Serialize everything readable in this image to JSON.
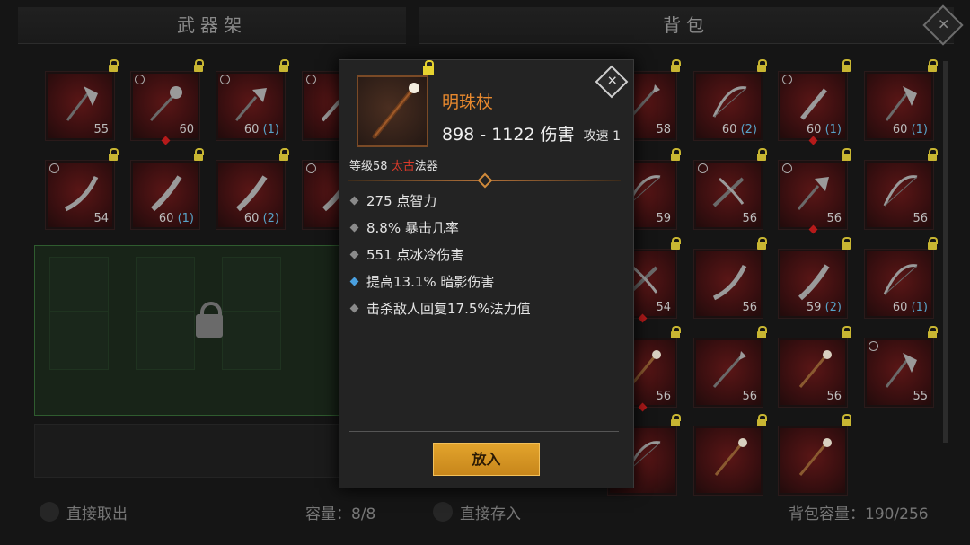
{
  "left_panel": {
    "title": "武器架",
    "footer_action": "直接取出",
    "footer_capacity": "容量：8/8",
    "slots": [
      {
        "level": "55",
        "enhance": "",
        "weapon": "axe",
        "ring": false,
        "gem": false
      },
      {
        "level": "60",
        "enhance": "",
        "weapon": "spiked-mace",
        "ring": true,
        "gem": true
      },
      {
        "level": "60",
        "enhance": "(1)",
        "weapon": "spiked-club",
        "ring": true,
        "gem": false
      },
      {
        "level": "",
        "enhance": "",
        "weapon": "sword",
        "ring": true,
        "gem": false
      },
      {
        "level": "54",
        "enhance": "",
        "weapon": "scimitar",
        "ring": true,
        "gem": false
      },
      {
        "level": "60",
        "enhance": "(1)",
        "weapon": "blade",
        "ring": false,
        "gem": false
      },
      {
        "level": "60",
        "enhance": "(2)",
        "weapon": "blade",
        "ring": false,
        "gem": false
      },
      {
        "level": "",
        "enhance": "",
        "weapon": "blade",
        "ring": true,
        "gem": false
      }
    ]
  },
  "right_panel": {
    "title": "背包",
    "footer_action": "直接存入",
    "footer_capacity": "背包容量：190/256",
    "slots": [
      {
        "level": "58",
        "enhance": "",
        "weapon": "spear",
        "ring": false,
        "gem": false
      },
      {
        "level": "60",
        "enhance": "(2)",
        "weapon": "bow",
        "ring": false,
        "gem": false
      },
      {
        "level": "60",
        "enhance": "(1)",
        "weapon": "dagger",
        "ring": true,
        "gem": true
      },
      {
        "level": "60",
        "enhance": "(1)",
        "weapon": "axe",
        "ring": false,
        "gem": false
      },
      {
        "level": "59",
        "enhance": "",
        "weapon": "bow",
        "ring": false,
        "gem": false
      },
      {
        "level": "56",
        "enhance": "",
        "weapon": "crossbow",
        "ring": true,
        "gem": false
      },
      {
        "level": "56",
        "enhance": "",
        "weapon": "spiked-club",
        "ring": true,
        "gem": true
      },
      {
        "level": "56",
        "enhance": "",
        "weapon": "bow",
        "ring": false,
        "gem": false
      },
      {
        "level": "54",
        "enhance": "",
        "weapon": "crossbow",
        "ring": false,
        "gem": true
      },
      {
        "level": "56",
        "enhance": "",
        "weapon": "scimitar",
        "ring": false,
        "gem": false
      },
      {
        "level": "59",
        "enhance": "(2)",
        "weapon": "blade",
        "ring": false,
        "gem": false
      },
      {
        "level": "60",
        "enhance": "(1)",
        "weapon": "bow",
        "ring": false,
        "gem": false
      },
      {
        "level": "56",
        "enhance": "",
        "weapon": "staff",
        "ring": false,
        "gem": true
      },
      {
        "level": "56",
        "enhance": "",
        "weapon": "spear",
        "ring": false,
        "gem": false
      },
      {
        "level": "56",
        "enhance": "",
        "weapon": "staff",
        "ring": false,
        "gem": false
      },
      {
        "level": "55",
        "enhance": "",
        "weapon": "axe",
        "ring": true,
        "gem": false
      },
      {
        "level": "",
        "enhance": "",
        "weapon": "bow",
        "ring": false,
        "gem": false
      },
      {
        "level": "",
        "enhance": "",
        "weapon": "staff",
        "ring": false,
        "gem": false
      },
      {
        "level": "",
        "enhance": "",
        "weapon": "staff",
        "ring": false,
        "gem": false
      }
    ]
  },
  "tooltip": {
    "name": "明珠杖",
    "damage": "898 - 1122 伤害",
    "attack_speed": "攻速 1",
    "level_prefix": "等级58",
    "tier": "太古",
    "type": "法器",
    "stats": [
      {
        "text": "275 点智力",
        "bullet": "gray"
      },
      {
        "text": "8.8% 暴击几率",
        "bullet": "gray"
      },
      {
        "text": "551 点冰冷伤害",
        "bullet": "gray"
      },
      {
        "text": "提高13.1% 暗影伤害",
        "bullet": "blue"
      },
      {
        "text": "击杀敌人回复17.5%法力值",
        "bullet": "gray"
      }
    ],
    "button_label": "放入",
    "close_icon": "close-icon"
  },
  "colors": {
    "item_name": "#e8892e",
    "tier_red": "#d93a2a",
    "enhance_blue": "#58a3c8",
    "button_gold": "#e3a42c",
    "lock_yellow": "#c8b632"
  }
}
